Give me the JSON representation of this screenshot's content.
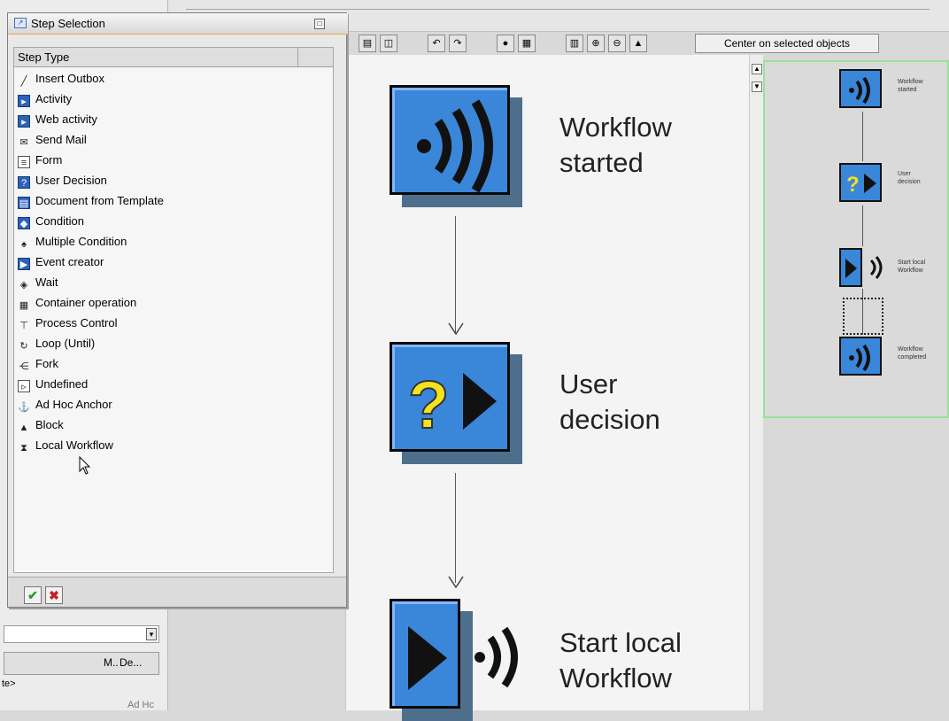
{
  "dialog": {
    "title": "Step Selection",
    "column_header": "Step Type",
    "items": [
      {
        "label": "Insert Outbox",
        "icon": "line-icon"
      },
      {
        "label": "Activity",
        "icon": "activity-icon"
      },
      {
        "label": "Web activity",
        "icon": "web-activity-icon"
      },
      {
        "label": "Send Mail",
        "icon": "send-mail-icon"
      },
      {
        "label": "Form",
        "icon": "form-icon"
      },
      {
        "label": "User Decision",
        "icon": "user-decision-icon"
      },
      {
        "label": "Document from Template",
        "icon": "document-template-icon"
      },
      {
        "label": "Condition",
        "icon": "condition-icon"
      },
      {
        "label": "Multiple Condition",
        "icon": "multiple-condition-icon"
      },
      {
        "label": "Event creator",
        "icon": "event-creator-icon"
      },
      {
        "label": "Wait",
        "icon": "wait-icon"
      },
      {
        "label": "Container operation",
        "icon": "container-operation-icon"
      },
      {
        "label": "Process Control",
        "icon": "process-control-icon"
      },
      {
        "label": "Loop (Until)",
        "icon": "loop-icon"
      },
      {
        "label": "Fork",
        "icon": "fork-icon"
      },
      {
        "label": "Undefined",
        "icon": "undefined-icon"
      },
      {
        "label": "Ad Hoc Anchor",
        "icon": "ad-hoc-anchor-icon"
      },
      {
        "label": "Block",
        "icon": "block-icon"
      },
      {
        "label": "Local Workflow",
        "icon": "local-workflow-icon"
      }
    ]
  },
  "toolbar": {
    "center_label": "Center on selected objects"
  },
  "workflow": {
    "nodes": [
      {
        "line1": "Workflow",
        "line2": "started"
      },
      {
        "line1": "User",
        "line2": "decision"
      },
      {
        "line1": "Start local",
        "line2": "Workflow"
      }
    ]
  },
  "overview": {
    "labels": [
      {
        "line1": "Workflow",
        "line2": "started"
      },
      {
        "line1": "User",
        "line2": "decision"
      },
      {
        "line1": "Start local",
        "line2": "Workflow"
      },
      {
        "line1": "Workflow",
        "line2": "completed"
      }
    ]
  },
  "bottom_panel": {
    "col_m": "M..",
    "col_de": "De...",
    "row_text": "te>",
    "row_text2": "Ad Hc"
  },
  "colors": {
    "node_blue": "#3a86d8",
    "dialog_accent": "#f0a848",
    "overview_border": "#9be09b"
  }
}
